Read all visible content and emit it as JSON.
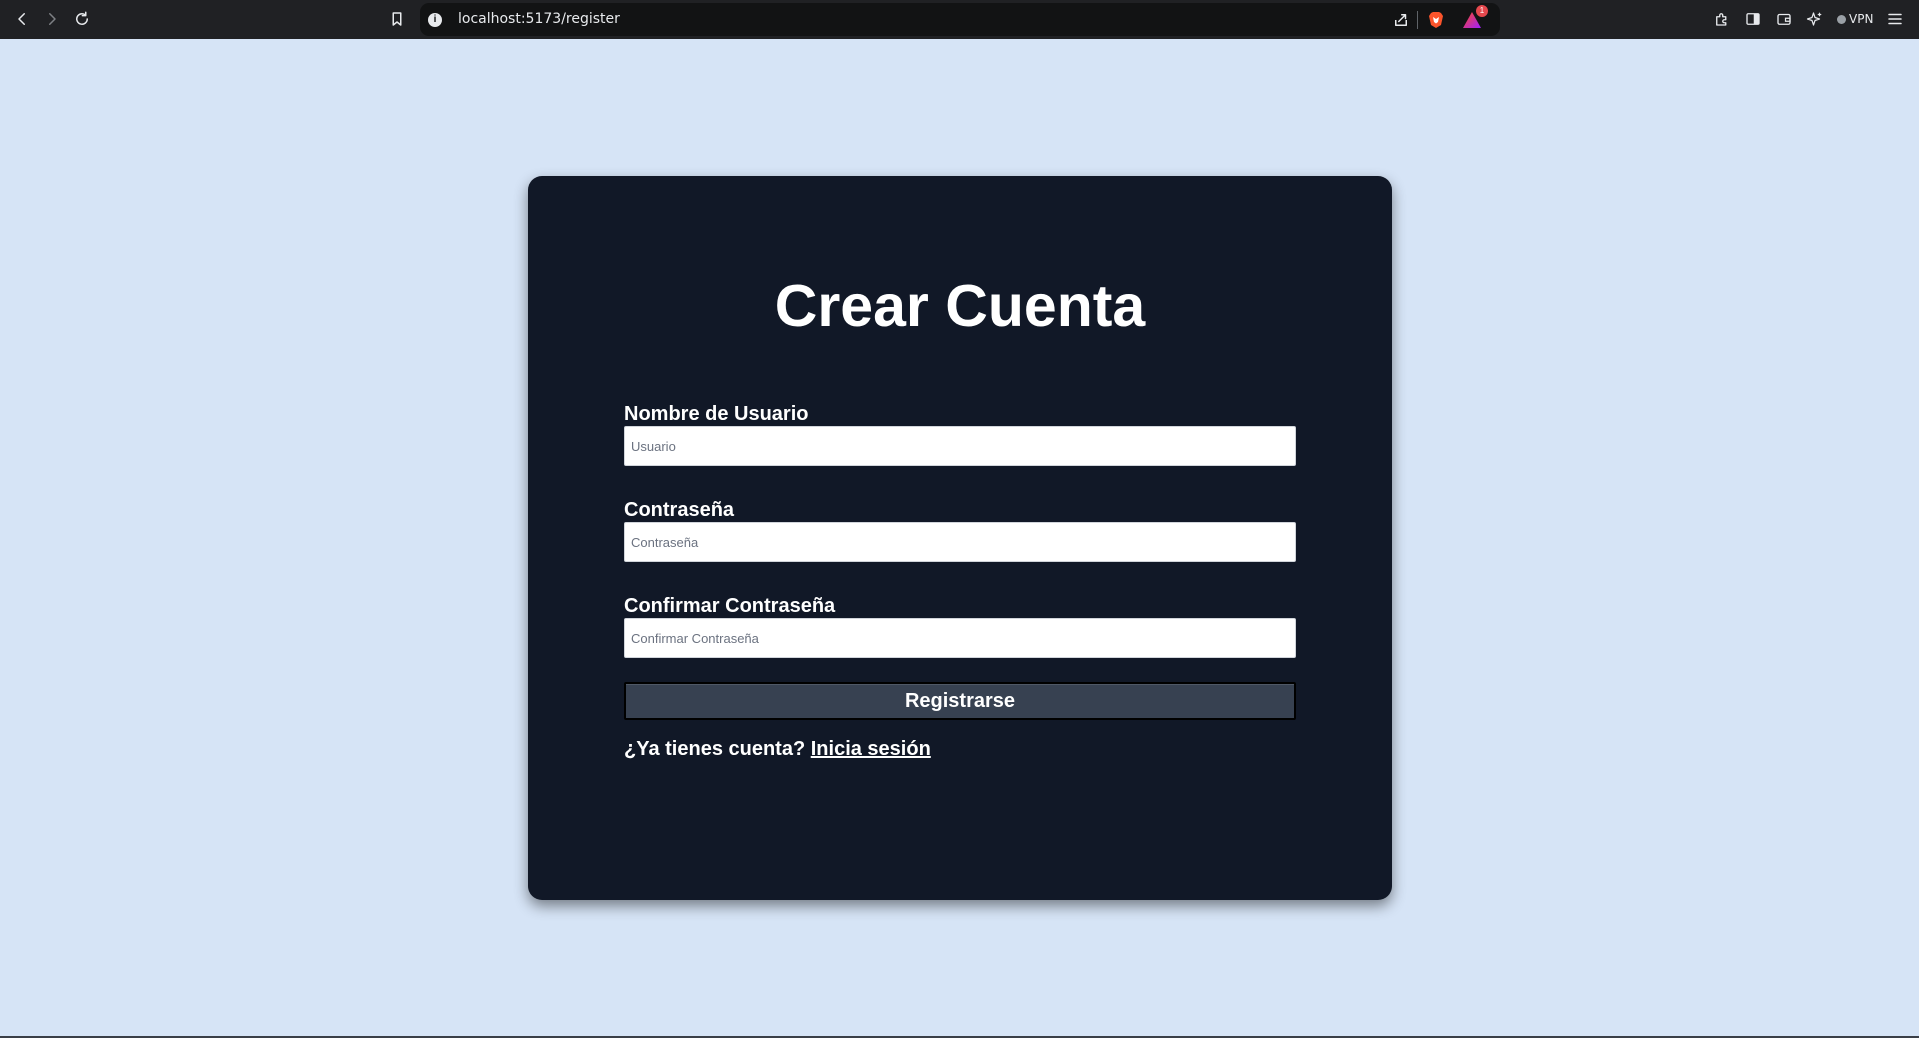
{
  "browser": {
    "url": "localhost:5173/register",
    "vpn_label": "VPN",
    "rewards_badge": "1"
  },
  "register": {
    "title": "Crear Cuenta",
    "username": {
      "label": "Nombre de Usuario",
      "placeholder": "Usuario"
    },
    "password": {
      "label": "Contraseña",
      "placeholder": "Contraseña"
    },
    "confirm": {
      "label": "Confirmar Contraseña",
      "placeholder": "Confirmar Contraseña"
    },
    "submit_label": "Registrarse",
    "login_prompt": "¿Ya tienes cuenta?",
    "login_link": "Inicia sesión"
  },
  "colors": {
    "page_background": "#d6e4f6",
    "card_background": "#111827",
    "button_background": "#374151",
    "browser_chrome": "#202124"
  }
}
